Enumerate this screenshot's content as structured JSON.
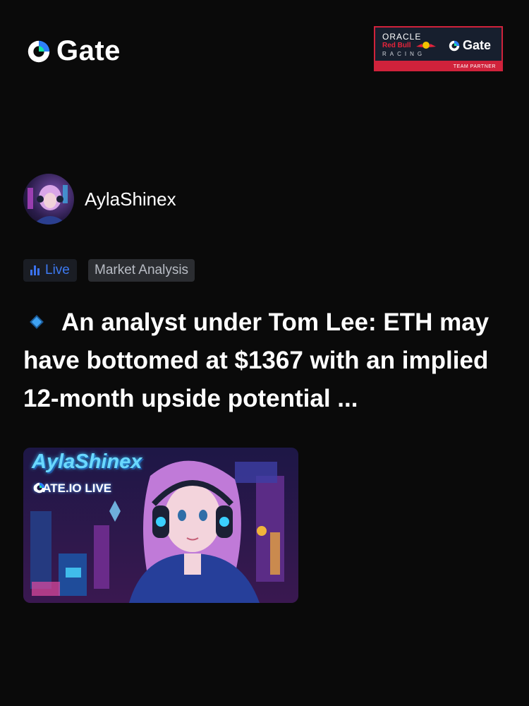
{
  "brand": {
    "logo_text": "Gate",
    "accent": "#2d7ff9"
  },
  "partner_badge": {
    "oracle": "ORACLE",
    "redbull": "Red Bull",
    "racing": "RACING",
    "gate": "Gate",
    "partner": "TEAM PARTNER",
    "colors": {
      "border": "#d0223b",
      "background": "#171f2e"
    }
  },
  "author": {
    "name": "AylaShinex",
    "avatar_icon": "avatar-image"
  },
  "tags": {
    "live": "Live",
    "category": "Market Analysis"
  },
  "headline": {
    "icon": "blue-diamond-icon",
    "text": "An analyst under Tom Lee: ETH may have bottomed at $1367 with an implied 12-month upside potential ..."
  },
  "thumbnail": {
    "title": "AylaShinex",
    "live_label": "GATE.IO LIVE"
  }
}
